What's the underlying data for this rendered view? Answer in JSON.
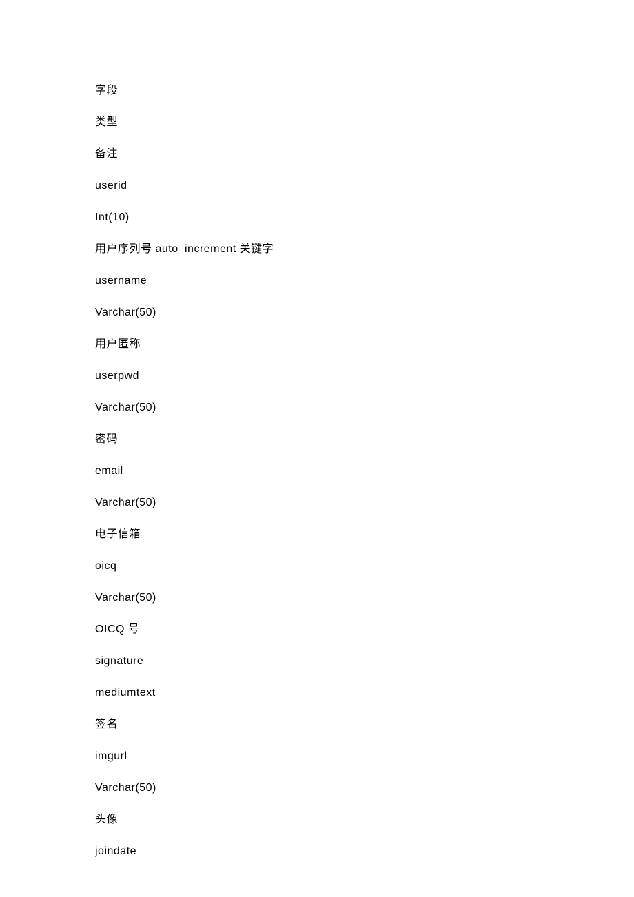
{
  "lines": [
    "字段",
    "类型",
    "备注",
    "userid",
    "Int(10)",
    "用户序列号 auto_increment 关键字",
    "username",
    "Varchar(50)",
    "用户匿称",
    "userpwd",
    "Varchar(50)",
    "密码",
    "email",
    "Varchar(50)",
    "电子信箱",
    "oicq",
    "Varchar(50)",
    "OICQ 号",
    "signature",
    "mediumtext",
    "签名",
    "imgurl",
    "Varchar(50)",
    "头像",
    "joindate"
  ]
}
